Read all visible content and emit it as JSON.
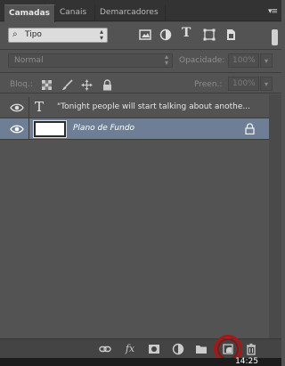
{
  "tabs": [
    {
      "label": "Camadas",
      "active": true
    },
    {
      "label": "Canais",
      "active": false
    },
    {
      "label": "Demarcadores",
      "active": false
    }
  ],
  "filter": {
    "value": "Tipo"
  },
  "blend_mode": {
    "value": "Normal"
  },
  "opacity": {
    "label": "Opacidade:",
    "value": "100%"
  },
  "lock": {
    "label": "Bloq.:"
  },
  "fill": {
    "label": "Preen.:",
    "value": "100%"
  },
  "layers": [
    {
      "name": "\"Tonight people will start talking about anothe...",
      "kind": "text",
      "visible": true,
      "selected": false
    },
    {
      "name": "Plano de Fundo",
      "kind": "background",
      "visible": true,
      "selected": true
    }
  ],
  "taskbar": {
    "time": "14:25"
  },
  "colors": {
    "selected_layer": "#6e7f95",
    "panel_bg": "#535353",
    "highlight_circle": "#a51818"
  }
}
